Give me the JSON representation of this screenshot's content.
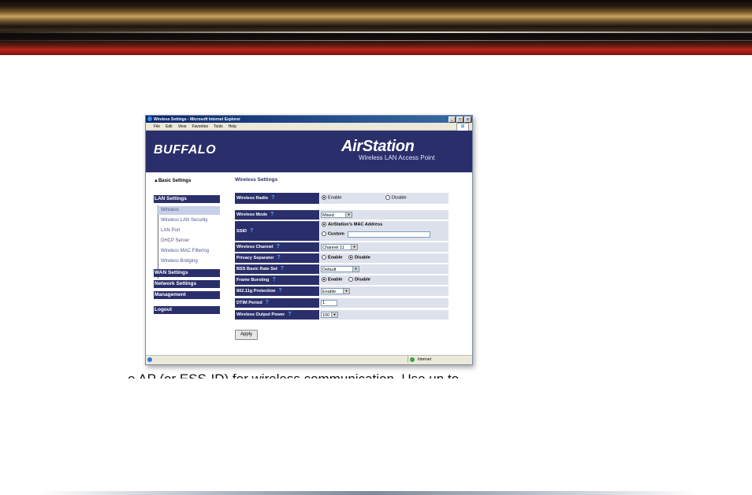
{
  "window": {
    "title": "Wireless Settings - Microsoft Internet Explorer",
    "buttons": [
      "_",
      "□",
      "x"
    ],
    "menu": [
      "File",
      "Edit",
      "View",
      "Favorites",
      "Tools",
      "Help"
    ]
  },
  "header": {
    "brand": "BUFFALO",
    "product": "AirStation",
    "product_sub": "Wireless LAN Access Point"
  },
  "sidebar": {
    "basic": "▲Basic Settings",
    "lan": "LAN Settings",
    "lan_items": [
      "Wireless",
      "Wireless LAN Security",
      "LAN Port",
      "DHCP Server",
      "Wireless MAC Filtering",
      "Wireless Bridging"
    ],
    "wan": "WAN Settings",
    "network": "Network Settings",
    "management": "Management",
    "logout": "Logout"
  },
  "main": {
    "title": "Wireless Settings",
    "rows": [
      {
        "label": "Wireless Radio",
        "opt1": "Enable",
        "opt2": "Disable"
      },
      {
        "label": "Wireless Mode",
        "value": "Mixed"
      },
      {
        "label": "SSID",
        "opt1": "AirStation's MAC Address",
        "opt2": "Custom"
      },
      {
        "label": "Wireless Channel",
        "value": "Channel 11"
      },
      {
        "label": "Privacy Separator",
        "opt1": "Enable",
        "opt2": "Disable"
      },
      {
        "label": "BSS Basic Rate Set",
        "value": "Default"
      },
      {
        "label": "Frame Bursting",
        "opt1": "Enable",
        "opt2": "Disable"
      },
      {
        "label": "802.11g Protection",
        "value": "Enable"
      },
      {
        "label": "DTIM Period",
        "value": "1"
      },
      {
        "label": "Wireless Output Power",
        "value": "100"
      }
    ],
    "apply": "Apply"
  },
  "status": {
    "zone": "Internet"
  },
  "caption_fragment": "e AP (or ESS-ID) for wireless communication.  Use up to"
}
